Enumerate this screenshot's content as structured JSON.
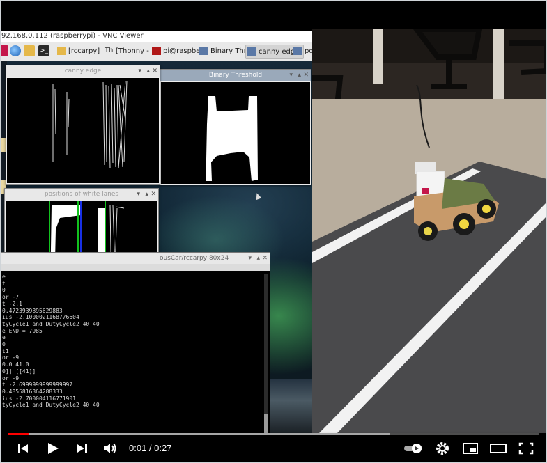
{
  "vnc": {
    "title": "92.168.0.112 (raspberrypi) - VNC Viewer",
    "taskbar": [
      {
        "label": "[rccarpy]"
      },
      {
        "label": "[Thonny - ..."
      },
      {
        "label": "pi@raspbe..."
      },
      {
        "label": "Binary Thr..."
      },
      {
        "label": "canny edge"
      },
      {
        "label": "po"
      }
    ]
  },
  "windows": {
    "canny": {
      "title": "canny edge"
    },
    "binary": {
      "title": "Binary Threshold"
    },
    "positions": {
      "title": "positions of white lanes"
    },
    "terminal": {
      "title": "ousCar/rccarpy 80x24"
    }
  },
  "terminal_lines": [
    "e",
    "t",
    "0",
    "or -7",
    "t -2.1",
    "0.4723939895629883",
    "ius -2.1000021168776604",
    "tyCycle1 and DutyCycle2 40 40",
    "e END = 7985",
    "e",
    "0",
    "t1",
    "or -9",
    "0.0 41.0",
    "0]] [[41]]",
    "or -9",
    "t -2.6999999999999997",
    "0.4855816364288333",
    "ius -2.700004116771901",
    "tyCycle1 and DutyCycle2 40 40"
  ],
  "player": {
    "time": "0:01 / 0:27",
    "progress_played": 0.04,
    "progress_buffered": 0.72,
    "icons": [
      "previous-icon",
      "play-icon",
      "next-icon",
      "volume-icon",
      "autoplay-toggle-icon",
      "settings-gear-icon",
      "miniplayer-icon",
      "theater-mode-icon",
      "fullscreen-icon"
    ]
  }
}
